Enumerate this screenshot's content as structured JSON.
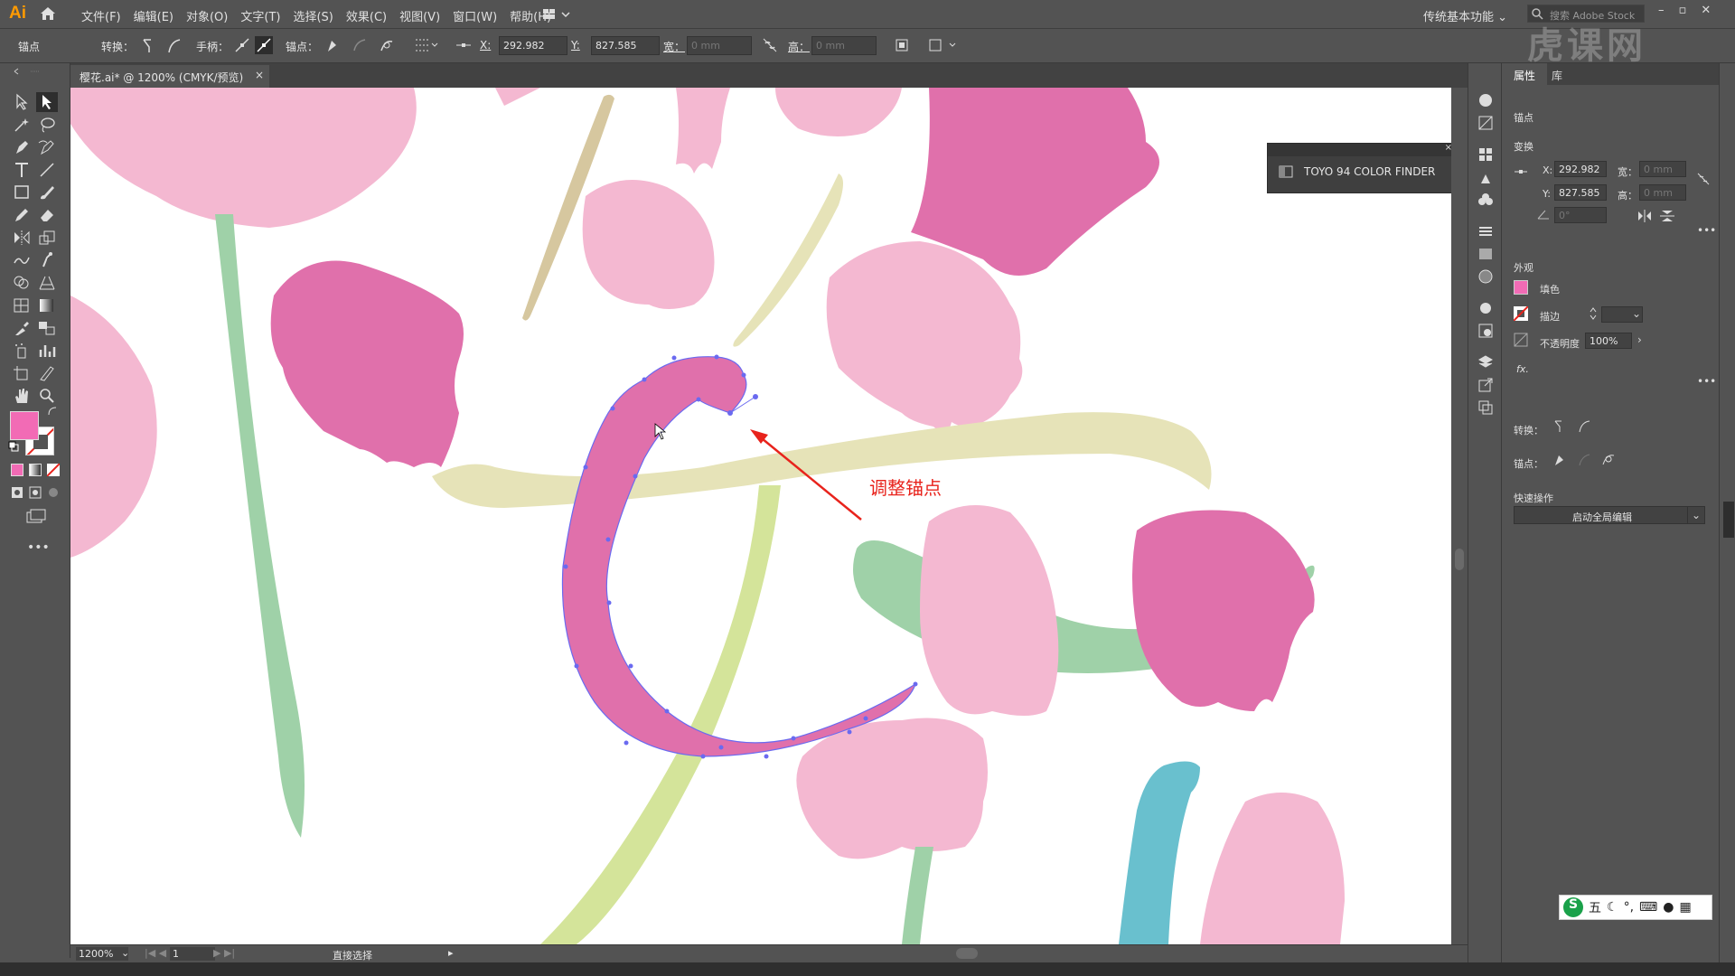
{
  "app": {
    "logo": "Ai"
  },
  "menu": [
    "文件(F)",
    "编辑(E)",
    "对象(O)",
    "文字(T)",
    "选择(S)",
    "效果(C)",
    "视图(V)",
    "窗口(W)",
    "帮助(H)"
  ],
  "workspace": "传统基本功能",
  "search_placeholder": "搜索 Adobe Stock",
  "control": {
    "anchor_label": "锚点",
    "convert_label": "转换：",
    "handle_label": "手柄：",
    "anchor2_label": "锚点：",
    "x_label": "X:",
    "x_value": "292.982",
    "y_label": "Y:",
    "y_value": "827.585",
    "w_label": "宽：",
    "w_value": "0 mm",
    "h_label": "高：",
    "h_value": "0 mm"
  },
  "document": {
    "tab_title": "樱花.ai* @ 1200% (CMYK/预览)"
  },
  "status": {
    "zoom": "1200%",
    "page": "1",
    "tool": "直接选择"
  },
  "panel": {
    "tabs": [
      "属性",
      "库"
    ],
    "anchor_title": "锚点",
    "transform_title": "变换",
    "x_label": "X:",
    "x_value": "292.982",
    "y_label": "Y:",
    "y_value": "827.585",
    "w_label": "宽：",
    "w_value": "0 mm",
    "h_label": "高：",
    "h_value": "0 mm",
    "angle_value": "0°",
    "appearance_title": "外观",
    "fill_label": "填色",
    "stroke_label": "描边",
    "opacity_label": "不透明度",
    "opacity_value": "100%",
    "fx_label": "fx.",
    "convert_label": "转换：",
    "anchor_label": "锚点：",
    "quick_title": "快速操作",
    "quick_button": "启动全局编辑"
  },
  "toyo_panel": {
    "title": "TOYO 94 COLOR FINDER"
  },
  "annotation": "调整锚点",
  "watermark": "虎课网",
  "ime": {
    "label": "五"
  },
  "colors": {
    "fill": "#f26bb5",
    "selection": "#6a6af0",
    "annotation": "#e8231c",
    "path": "#e070ab"
  }
}
